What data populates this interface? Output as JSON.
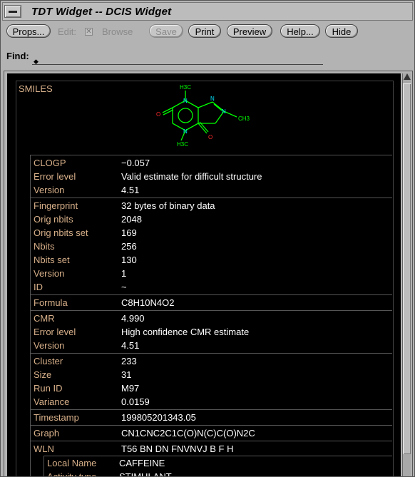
{
  "window": {
    "title": "TDT Widget -- DCIS Widget"
  },
  "toolbar": {
    "props_label": "Props...",
    "edit_label": "Edit:",
    "browse_label": "Browse",
    "save_label": "Save",
    "print_label": "Print",
    "preview_label": "Preview",
    "help_label": "Help...",
    "hide_label": "Hide"
  },
  "find": {
    "label": "Find:",
    "value": ""
  },
  "record": {
    "smiles_label": "SMILES",
    "molecule_atoms": {
      "h3c_top": "H3C",
      "ch3_right": "CH3",
      "h3c_bottom": "H3C",
      "n": "N",
      "o": "O"
    },
    "groups": [
      {
        "rows": [
          {
            "key": "CLOGP",
            "value": "−0.057"
          },
          {
            "key": "Error level",
            "value": "Valid estimate for difficult structure"
          },
          {
            "key": "Version",
            "value": "4.51"
          }
        ]
      },
      {
        "rows": [
          {
            "key": "Fingerprint",
            "value": "32 bytes of binary data"
          },
          {
            "key": "Orig nbits",
            "value": "2048"
          },
          {
            "key": "Orig nbits set",
            "value": "169"
          },
          {
            "key": "Nbits",
            "value": "256"
          },
          {
            "key": "Nbits set",
            "value": "130"
          },
          {
            "key": "Version",
            "value": "1"
          },
          {
            "key": "ID",
            "value": "~"
          }
        ]
      },
      {
        "rows": [
          {
            "key": "Formula",
            "value": "C8H10N4O2"
          }
        ]
      },
      {
        "rows": [
          {
            "key": "CMR",
            "value": "4.990"
          },
          {
            "key": "Error level",
            "value": "High confidence CMR estimate"
          },
          {
            "key": "Version",
            "value": "4.51"
          }
        ]
      },
      {
        "rows": [
          {
            "key": "Cluster",
            "value": "233"
          },
          {
            "key": "Size",
            "value": "31"
          },
          {
            "key": "Run ID",
            "value": "M97"
          },
          {
            "key": "Variance",
            "value": "0.0159"
          }
        ]
      },
      {
        "rows": [
          {
            "key": "Timestamp",
            "value": "199805201343.05"
          }
        ]
      },
      {
        "rows": [
          {
            "key": "Graph",
            "value": "CN1CNC2C1C(O)N(C)C(O)N2C"
          }
        ]
      },
      {
        "rows": [
          {
            "key": "WLN",
            "value": "T56 BN DN FNVNVJ B F H"
          }
        ]
      }
    ],
    "sub_rows": [
      {
        "key": "Local Name",
        "value": "CAFFEINE"
      },
      {
        "key": "Activity type",
        "value": "STIMULANT"
      }
    ]
  },
  "colors": {
    "key_text": "#d8b08a",
    "value_text": "#ffffff",
    "bond": "#00ff00",
    "nitrogen": "#00e5ff",
    "oxygen": "#ff2a2a",
    "panel_bg": "#000000",
    "chrome_bg": "#b3b3b3"
  }
}
